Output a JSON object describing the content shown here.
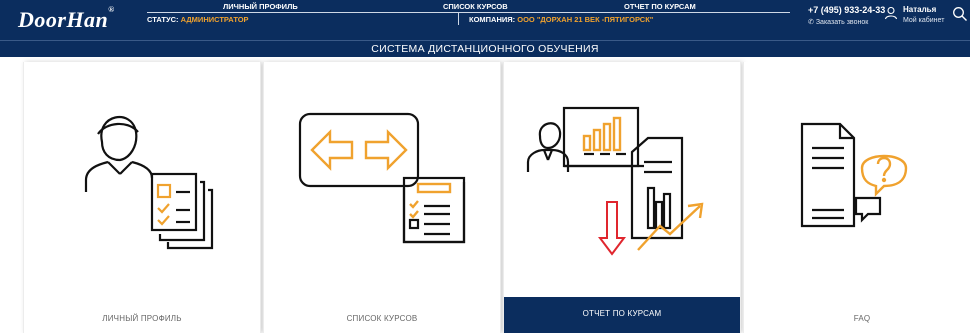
{
  "header": {
    "logo": "DoorHan",
    "logo_mark": "®",
    "nav": [
      {
        "label": "ЛИЧНЫЙ ПРОФИЛЬ"
      },
      {
        "label": "СПИСОК КУРСОВ"
      },
      {
        "label": "ОТЧЕТ ПО КУРСАМ"
      }
    ],
    "status_label": "СТАТУС:",
    "status_value": "АДМИНИСТРАТОР",
    "company_label": "КОМПАНИЯ:",
    "company_value": "ООО \"ДОРХАН 21 ВЕК -ПЯТИГОРСК\"",
    "phone": "+7 (495) 933-24-33",
    "callback": "Заказать звонок",
    "user_name": "Наталья",
    "cabinet": "Мой кабинет"
  },
  "subtitle": "СИСТЕМА ДИСТАНЦИОННОГО ОБУЧЕНИЯ",
  "cards": [
    {
      "label": "ЛИЧНЫЙ ПРОФИЛЬ",
      "icon": "user-document-icon"
    },
    {
      "label": "СПИСОК КУРСОВ",
      "icon": "course-list-icon"
    },
    {
      "label": "ОТЧЕТ ПО КУРСАМ",
      "icon": "report-chart-icon",
      "active": true
    },
    {
      "label": "FAQ",
      "icon": "faq-icon"
    }
  ],
  "colors": {
    "navy": "#0b2d5e",
    "accent": "#f0a22e",
    "arrow": "#e0262e"
  }
}
